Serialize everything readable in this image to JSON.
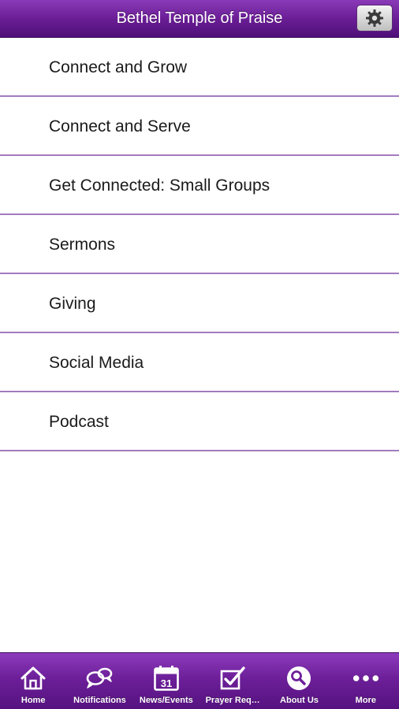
{
  "header": {
    "title": "Bethel Temple of Praise",
    "settings_icon": "gear-icon"
  },
  "menu": {
    "items": [
      {
        "label": "Connect and Grow"
      },
      {
        "label": "Connect and Serve"
      },
      {
        "label": "Get Connected: Small Groups"
      },
      {
        "label": "Sermons"
      },
      {
        "label": "Giving"
      },
      {
        "label": "Social Media"
      },
      {
        "label": "Podcast"
      }
    ]
  },
  "tabbar": {
    "tabs": [
      {
        "label": "Home",
        "icon": "home-icon"
      },
      {
        "label": "Notifications",
        "icon": "chat-bubbles-icon"
      },
      {
        "label": "News/Events",
        "icon": "calendar-icon",
        "calendar_day": "31"
      },
      {
        "label": "Prayer Req…",
        "icon": "checkbox-icon"
      },
      {
        "label": "About Us",
        "icon": "magnifier-icon"
      },
      {
        "label": "More",
        "icon": "more-dots-icon"
      }
    ]
  },
  "colors": {
    "brand_purple": "#6b1e96",
    "divider": "#a27bbf",
    "text": "#1a1a1a"
  }
}
